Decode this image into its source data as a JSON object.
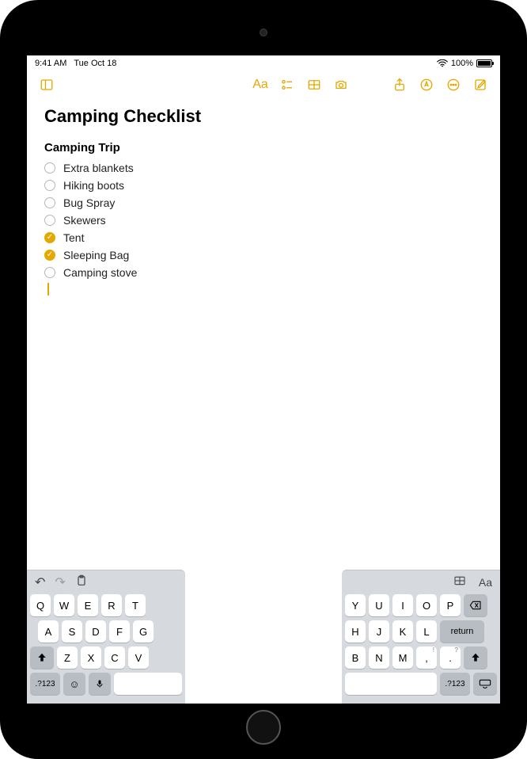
{
  "status": {
    "time": "9:41 AM",
    "date": "Tue Oct 18",
    "battery": "100%"
  },
  "note": {
    "title": "Camping Checklist",
    "heading": "Camping Trip",
    "items": [
      {
        "label": "Extra blankets",
        "checked": false
      },
      {
        "label": "Hiking boots",
        "checked": false
      },
      {
        "label": "Bug Spray",
        "checked": false
      },
      {
        "label": "Skewers",
        "checked": false
      },
      {
        "label": "Tent",
        "checked": true
      },
      {
        "label": "Sleeping Bag",
        "checked": true
      },
      {
        "label": "Camping stove",
        "checked": false
      }
    ]
  },
  "toolbar": {
    "aa_label": "Aa"
  },
  "keyboard": {
    "left": {
      "row1": [
        "Q",
        "W",
        "E",
        "R",
        "T"
      ],
      "row2": [
        "A",
        "S",
        "D",
        "F",
        "G"
      ],
      "row3": [
        "Z",
        "X",
        "C",
        "V"
      ],
      "mode": ".?123"
    },
    "right": {
      "row1": [
        "Y",
        "U",
        "I",
        "O",
        "P"
      ],
      "row2": [
        "H",
        "J",
        "K",
        "L"
      ],
      "row3": [
        "B",
        "N",
        "M"
      ],
      "row3sym": [
        ",",
        "!",
        ".",
        "?"
      ],
      "return": "return",
      "mode": ".?123"
    }
  }
}
